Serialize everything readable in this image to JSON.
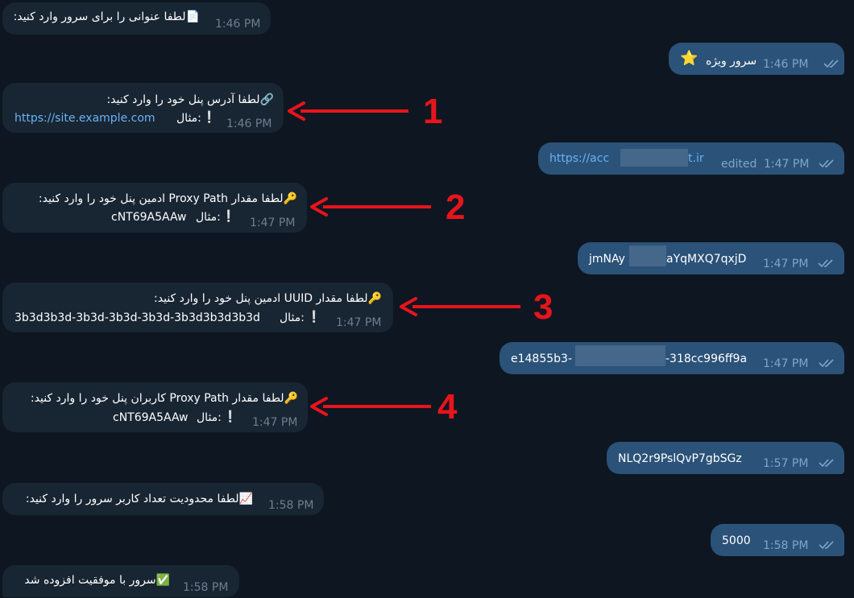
{
  "messages": {
    "m1": {
      "text": "لطفا عنوانی را برای سرور وارد کنید:",
      "icon": "📄",
      "time": "1:46 PM"
    },
    "m2": {
      "text": "سرور ویژه",
      "icon": "⭐",
      "time": "1:46 PM"
    },
    "m3": {
      "line1": "لطفا آدرس پنل خود را وارد کنید:",
      "icon": "🔗",
      "example_label": "مثال:",
      "example_value": "https://site.example.com",
      "time": "1:46 PM"
    },
    "m4": {
      "text_visible_left": "https://acc",
      "text_visible_right": "t.ir",
      "edited": "edited",
      "time": "1:47 PM"
    },
    "m5": {
      "line1": "لطفا مقدار Proxy Path ادمین پنل خود را وارد کنید:",
      "icon": "🔑",
      "example_label": "مثال:",
      "example_value": "cNT69A5AAw",
      "time": "1:47 PM"
    },
    "m6": {
      "text_visible_left": "jmNAy",
      "text_visible_right": "aYqMXQ7qxjD",
      "time": "1:47 PM"
    },
    "m7": {
      "line1": "لطفا مقدار UUID ادمین پنل خود را وارد کنید:",
      "icon": "🔑",
      "example_label": "مثال:",
      "example_value": "3b3d3b3d-3b3d-3b3d-3b3d-3b3d3b3d3b3d",
      "time": "1:47 PM"
    },
    "m8": {
      "text_visible_left": "e14855b3-",
      "text_visible_right": "-318cc996ff9a",
      "time": "1:47 PM"
    },
    "m9": {
      "line1": "لطفا مقدار Proxy Path کاربران پنل خود را وارد کنید:",
      "icon": "🔑",
      "example_label": "مثال:",
      "example_value": "cNT69A5AAw",
      "time": "1:47 PM"
    },
    "m10": {
      "text": "NLQ2r9PslQvP7gbSGz",
      "time": "1:57 PM"
    },
    "m11": {
      "text": "لطفا محدودیت تعداد کاربر سرور را وارد کنید:",
      "icon": "📈",
      "time": "1:58 PM"
    },
    "m12": {
      "text": "5000",
      "time": "1:58 PM"
    },
    "m13": {
      "text": "سرور با موفقیت افزوده شد",
      "icon": "✅",
      "time": "1:58 PM"
    }
  },
  "annotations": {
    "n1": "1",
    "n2": "2",
    "n3": "3",
    "n4": "4"
  },
  "colors": {
    "background": "#0e1621",
    "incoming": "#182533",
    "outgoing": "#2b5278",
    "arrow": "#e8141b",
    "link": "#6ab2f2"
  }
}
